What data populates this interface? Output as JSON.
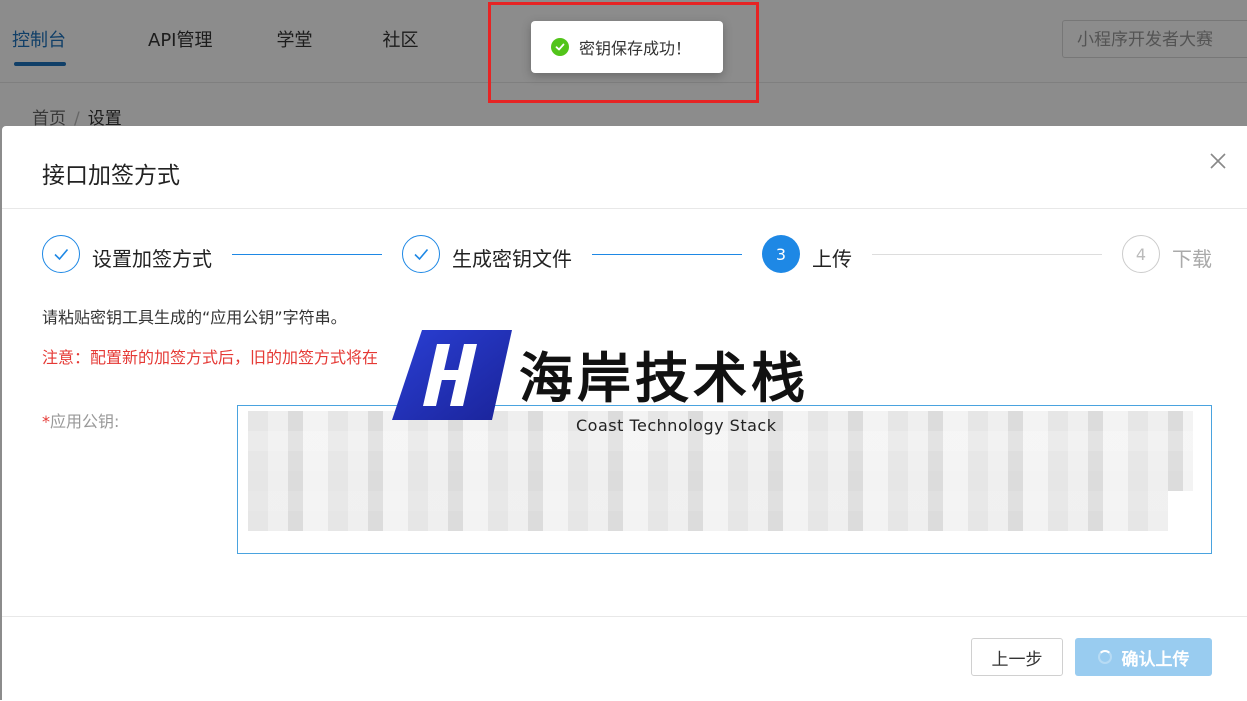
{
  "topnav": {
    "items": [
      {
        "label": "控制台",
        "active": true
      },
      {
        "label": "API管理",
        "active": false
      },
      {
        "label": "学堂",
        "active": false
      },
      {
        "label": "社区",
        "active": false
      }
    ],
    "search_placeholder": "小程序开发者大赛"
  },
  "breadcrumb": {
    "home": "首页",
    "separator": "/",
    "current": "设置"
  },
  "toast": {
    "message": "密钥保存成功！",
    "icon": "check-circle-icon",
    "color": "#52c41a"
  },
  "modal": {
    "title": "接口加签方式",
    "steps": [
      {
        "label": "设置加签方式",
        "status": "done"
      },
      {
        "label": "生成密钥文件",
        "status": "done"
      },
      {
        "label": "上传",
        "number": "3",
        "status": "active"
      },
      {
        "label": "下载",
        "number": "4",
        "status": "pending"
      }
    ],
    "hint": "请粘贴密钥工具生成的“应用公钥”字符串。",
    "warning": "注意：配置新的加签方式后，旧的加签方式将在",
    "field": {
      "required_mark": "*",
      "label": "应用公钥:"
    },
    "buttons": {
      "prev": "上一步",
      "confirm": "确认上传"
    }
  },
  "watermark": {
    "title": "海岸技术栈",
    "subtitle": "Coast Technology Stack"
  },
  "colors": {
    "accent": "#1e88e5",
    "nav_active": "#1e73be",
    "warning": "#e53935",
    "highlight": "#e62424"
  }
}
